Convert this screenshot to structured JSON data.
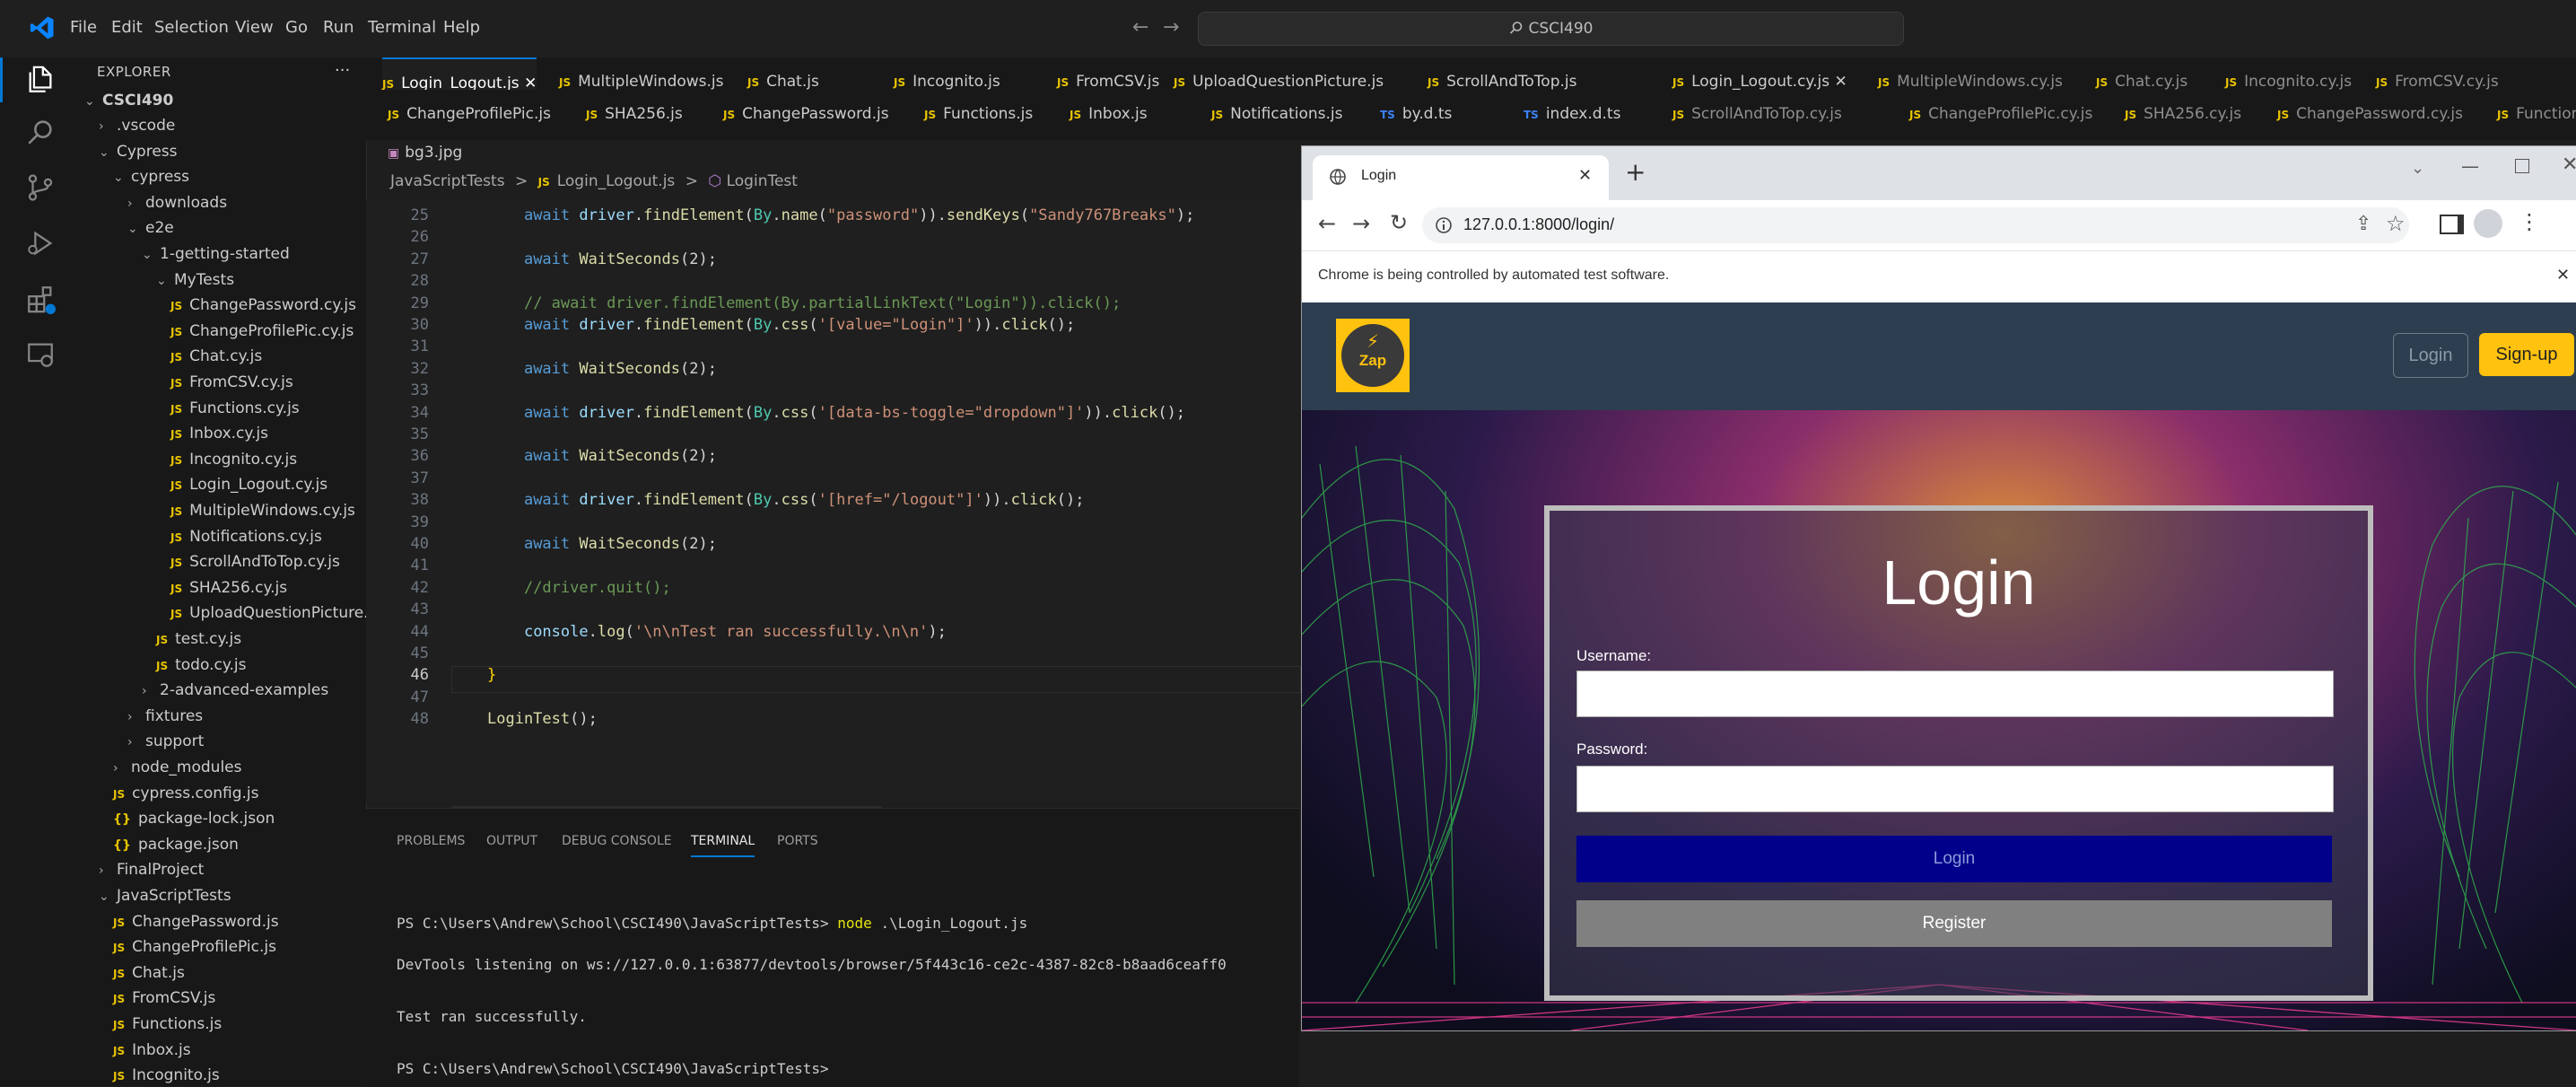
{
  "titlebar": {
    "menus": [
      "File",
      "Edit",
      "Selection",
      "View",
      "Go",
      "Run",
      "Terminal",
      "Help"
    ],
    "search": "CSCI490"
  },
  "explorer": {
    "header": "EXPLORER",
    "more": "···",
    "root": "CSCI490",
    "items": [
      {
        "label": ".vscode",
        "kind": "folder",
        "open": false,
        "indent": 1
      },
      {
        "label": "Cypress",
        "kind": "folder",
        "open": true,
        "indent": 1
      },
      {
        "label": "cypress",
        "kind": "folder",
        "open": true,
        "indent": 2
      },
      {
        "label": "downloads",
        "kind": "folder",
        "open": false,
        "indent": 3
      },
      {
        "label": "e2e",
        "kind": "folder",
        "open": true,
        "indent": 3
      },
      {
        "label": "1-getting-started",
        "kind": "folder",
        "open": true,
        "indent": 4
      },
      {
        "label": "MyTests",
        "kind": "folder",
        "open": true,
        "indent": 5
      },
      {
        "label": "ChangePassword.cy.js",
        "kind": "js",
        "indent": 6
      },
      {
        "label": "ChangeProfilePic.cy.js",
        "kind": "js",
        "indent": 6
      },
      {
        "label": "Chat.cy.js",
        "kind": "js",
        "indent": 6
      },
      {
        "label": "FromCSV.cy.js",
        "kind": "js",
        "indent": 6
      },
      {
        "label": "Functions.cy.js",
        "kind": "js",
        "indent": 6
      },
      {
        "label": "Inbox.cy.js",
        "kind": "js",
        "indent": 6
      },
      {
        "label": "Incognito.cy.js",
        "kind": "js",
        "indent": 6
      },
      {
        "label": "Login_Logout.cy.js",
        "kind": "js",
        "indent": 6
      },
      {
        "label": "MultipleWindows.cy.js",
        "kind": "js",
        "indent": 6
      },
      {
        "label": "Notifications.cy.js",
        "kind": "js",
        "indent": 6
      },
      {
        "label": "ScrollAndToTop.cy.js",
        "kind": "js",
        "indent": 6
      },
      {
        "label": "SHA256.cy.js",
        "kind": "js",
        "indent": 6
      },
      {
        "label": "UploadQuestionPicture.cy.js",
        "kind": "js",
        "indent": 6
      },
      {
        "label": "test.cy.js",
        "kind": "js",
        "indent": 5
      },
      {
        "label": "todo.cy.js",
        "kind": "js",
        "indent": 5
      },
      {
        "label": "2-advanced-examples",
        "kind": "folder",
        "open": false,
        "indent": 4
      },
      {
        "label": "fixtures",
        "kind": "folder",
        "open": false,
        "indent": 3
      },
      {
        "label": "support",
        "kind": "folder",
        "open": false,
        "indent": 3
      },
      {
        "label": "node_modules",
        "kind": "folder",
        "open": false,
        "indent": 2
      },
      {
        "label": "cypress.config.js",
        "kind": "js",
        "indent": 2
      },
      {
        "label": "package-lock.json",
        "kind": "json",
        "indent": 2
      },
      {
        "label": "package.json",
        "kind": "json",
        "indent": 2
      },
      {
        "label": "FinalProject",
        "kind": "folder",
        "open": false,
        "indent": 1
      },
      {
        "label": "JavaScriptTests",
        "kind": "folder",
        "open": true,
        "indent": 1
      },
      {
        "label": "ChangePassword.js",
        "kind": "js",
        "indent": 2
      },
      {
        "label": "ChangeProfilePic.js",
        "kind": "js",
        "indent": 2
      },
      {
        "label": "Chat.js",
        "kind": "js",
        "indent": 2
      },
      {
        "label": "FromCSV.js",
        "kind": "js",
        "indent": 2
      },
      {
        "label": "Functions.js",
        "kind": "js",
        "indent": 2
      },
      {
        "label": "Inbox.js",
        "kind": "js",
        "indent": 2
      },
      {
        "label": "Incognito.js",
        "kind": "js",
        "indent": 2
      }
    ]
  },
  "tabs_row1": [
    {
      "label": "Login_Logout.js",
      "active": true,
      "close": "✕"
    },
    {
      "label": "MultipleWindows.js"
    },
    {
      "label": "Chat.js"
    },
    {
      "label": "Incognito.js"
    },
    {
      "label": "FromCSV.js"
    },
    {
      "label": "UploadQuestionPicture.js"
    },
    {
      "label": "ScrollAndToTop.js"
    },
    {
      "label": "Login_Logout.cy.js",
      "close": "✕"
    },
    {
      "label": "MultipleWindows.cy.js",
      "dim": true
    },
    {
      "label": "Chat.cy.js",
      "dim": true
    },
    {
      "label": "Incognito.cy.js",
      "dim": true
    },
    {
      "label": "FromCSV.cy.js",
      "dim": true
    }
  ],
  "tabs_row2": [
    {
      "label": "ChangeProfilePic.js",
      "type": "JS"
    },
    {
      "label": "SHA256.js",
      "type": "JS"
    },
    {
      "label": "ChangePassword.js",
      "type": "JS"
    },
    {
      "label": "Functions.js",
      "type": "JS"
    },
    {
      "label": "Inbox.js",
      "type": "JS"
    },
    {
      "label": "Notifications.js",
      "type": "JS"
    },
    {
      "label": "by.d.ts",
      "type": "TS"
    },
    {
      "label": "index.d.ts",
      "type": "TS"
    },
    {
      "label": "ScrollAndToTop.cy.js",
      "type": "JS",
      "dim": true
    },
    {
      "label": "ChangeProfilePic.cy.js",
      "type": "JS",
      "dim": true
    },
    {
      "label": "SHA256.cy.js",
      "type": "JS",
      "dim": true
    },
    {
      "label": "ChangePassword.cy.js",
      "type": "JS",
      "dim": true
    },
    {
      "label": "Function",
      "type": "JS",
      "dim": true
    }
  ],
  "tabs_row3": [
    {
      "label": "bg3.jpg"
    }
  ],
  "breadcrumb": {
    "folder": "JavaScriptTests",
    "file": "Login_Logout.js",
    "symbol": "LoginTest",
    "sep": ">"
  },
  "code_lines": [
    {
      "n": "25",
      "html": "    <span class='kw'>await</span> <span class='var'>driver</span>.<span class='fn'>findElement</span>(<span class='cls'>By</span>.<span class='fn'>name</span>(<span class='str'>\"password\"</span>)).<span class='fn'>sendKeys</span>(<span class='str'>\"Sandy767Breaks\"</span>);"
    },
    {
      "n": "26",
      "html": ""
    },
    {
      "n": "27",
      "html": "    <span class='kw'>await</span> <span class='fn'>WaitSeconds</span>(2);"
    },
    {
      "n": "28",
      "html": ""
    },
    {
      "n": "29",
      "html": "    <span class='cm'>// await driver.findElement(By.partialLinkText(\"Login\")).click();</span>"
    },
    {
      "n": "30",
      "html": "    <span class='kw'>await</span> <span class='var'>driver</span>.<span class='fn'>findElement</span>(<span class='cls'>By</span>.<span class='fn'>css</span>(<span class='str'>'[value=\"Login\"]'</span>)).<span class='fn'>click</span>();"
    },
    {
      "n": "31",
      "html": ""
    },
    {
      "n": "32",
      "html": "    <span class='kw'>await</span> <span class='fn'>WaitSeconds</span>(2);"
    },
    {
      "n": "33",
      "html": ""
    },
    {
      "n": "34",
      "html": "    <span class='kw'>await</span> <span class='var'>driver</span>.<span class='fn'>findElement</span>(<span class='cls'>By</span>.<span class='fn'>css</span>(<span class='str'>'[data-bs-toggle=\"dropdown\"]'</span>)).<span class='fn'>click</span>();"
    },
    {
      "n": "35",
      "html": ""
    },
    {
      "n": "36",
      "html": "    <span class='kw'>await</span> <span class='fn'>WaitSeconds</span>(2);"
    },
    {
      "n": "37",
      "html": ""
    },
    {
      "n": "38",
      "html": "    <span class='kw'>await</span> <span class='var'>driver</span>.<span class='fn'>findElement</span>(<span class='cls'>By</span>.<span class='fn'>css</span>(<span class='str'>'[href=\"/logout\"]'</span>)).<span class='fn'>click</span>();"
    },
    {
      "n": "39",
      "html": ""
    },
    {
      "n": "40",
      "html": "    <span class='kw'>await</span> <span class='fn'>WaitSeconds</span>(2);"
    },
    {
      "n": "41",
      "html": ""
    },
    {
      "n": "42",
      "html": "    <span class='cm'>//driver.quit();</span>"
    },
    {
      "n": "43",
      "html": ""
    },
    {
      "n": "44",
      "html": "    <span class='var'>console</span>.<span class='fn'>log</span>(<span class='str'>'\\n\\nTest ran successfully.\\n\\n'</span>);"
    },
    {
      "n": "45",
      "html": ""
    },
    {
      "n": "46",
      "html": "<span class='br'>}</span>"
    },
    {
      "n": "47",
      "html": ""
    },
    {
      "n": "48",
      "html": "<span class='fn'>LoginTest</span>();"
    }
  ],
  "panel": {
    "tabs": [
      "PROBLEMS",
      "OUTPUT",
      "DEBUG CONSOLE",
      "TERMINAL",
      "PORTS"
    ],
    "active": "TERMINAL",
    "lines": [
      "PS C:\\Users\\Andrew\\School\\CSCI490\\JavaScriptTests> node .\\Login_Logout.js",
      "DevTools listening on ws://127.0.0.1:63877/devtools/browser/5f443c16-ce2c-4387-82c8-b8aad6ceaff0",
      "Test ran successfully.",
      "PS C:\\Users\\Andrew\\School\\CSCI490\\JavaScriptTests>"
    ],
    "cmd_highlight": "node"
  },
  "chrome": {
    "tab_title": "Login",
    "tab_close": "✕",
    "new_tab": "+",
    "url": "127.0.0.1:8000/login/",
    "infobar": "Chrome is being controlled by automated test software.",
    "infobar_close": "✕"
  },
  "site": {
    "logo_text": "Zap",
    "login_link": "Login",
    "signup_button": "Sign-up",
    "card_title": "Login",
    "username_label": "Username:",
    "password_label": "Password:",
    "login_button": "Login",
    "register_button": "Register"
  },
  "colors": {
    "brand": "#ffc20e",
    "login_btn": "#00008b",
    "register_btn": "#808080",
    "accent": "#0078d4"
  }
}
